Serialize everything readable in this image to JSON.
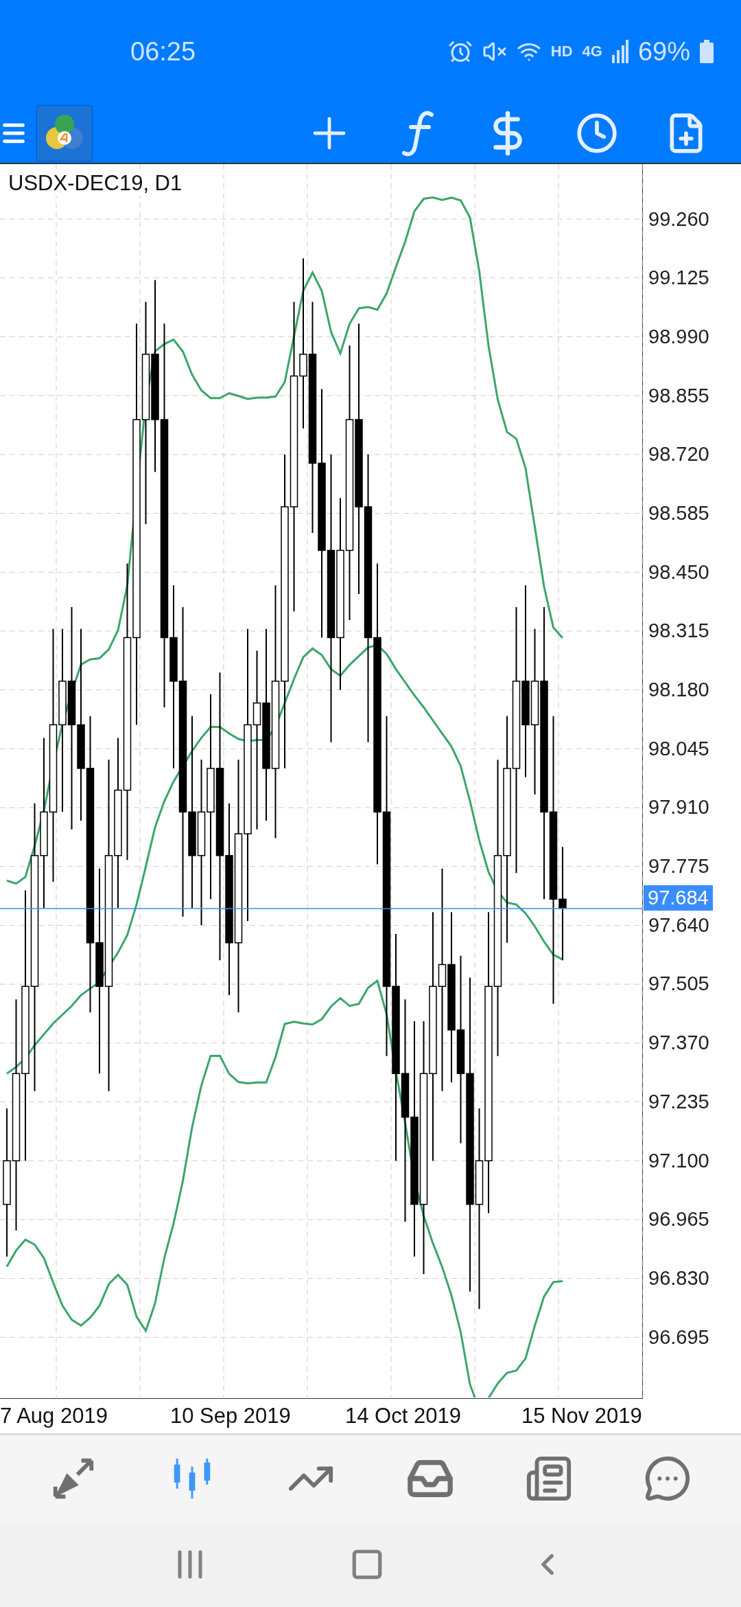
{
  "status_bar": {
    "time": "06:25",
    "network": "HD",
    "signal": "4G",
    "battery": "69%"
  },
  "chart": {
    "symbol": "USDX-DEC19, D1",
    "price_labels": [
      "99.260",
      "99.125",
      "98.990",
      "98.855",
      "98.720",
      "98.585",
      "98.450",
      "98.315",
      "98.180",
      "98.045",
      "97.910",
      "97.775",
      "97.640",
      "97.505",
      "97.370",
      "97.235",
      "97.100",
      "96.965",
      "96.830",
      "96.695"
    ],
    "current_price": "97.684",
    "dates": [
      "7 Aug 2019",
      "10 Sep 2019",
      "14 Oct 2019",
      "15 Nov 2019"
    ]
  },
  "bottom_nav": [
    {
      "selected": false
    },
    {
      "selected": true
    },
    {
      "selected": false
    },
    {
      "selected": false
    },
    {
      "selected": false
    },
    {
      "selected": false
    }
  ]
}
